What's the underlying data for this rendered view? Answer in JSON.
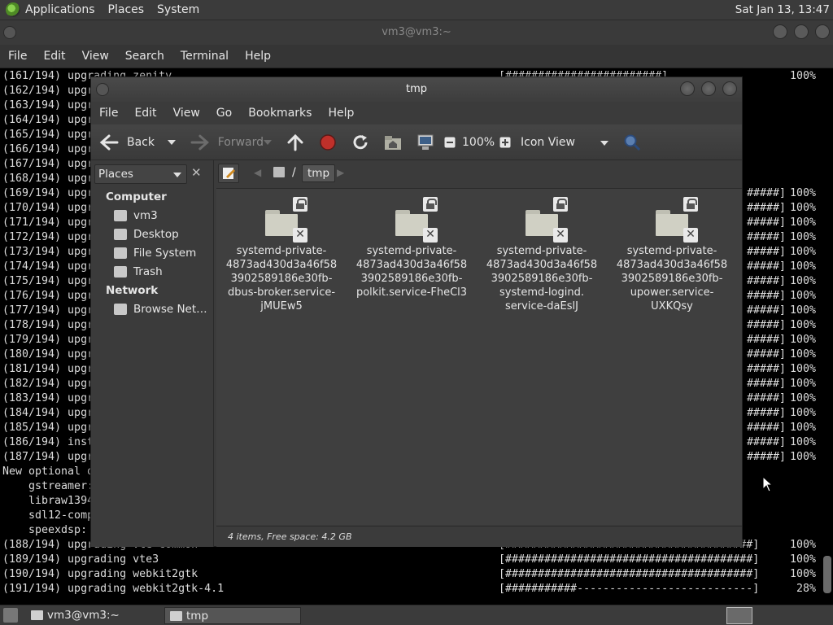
{
  "top_panel": {
    "menus": [
      "Applications",
      "Places",
      "System"
    ],
    "clock": "Sat Jan 13, 13:47"
  },
  "terminal": {
    "title": "vm3@vm3:~",
    "menus": [
      "File",
      "Edit",
      "View",
      "Search",
      "Terminal",
      "Help"
    ],
    "lines": [
      {
        "text": "(161/194) upgrading zenity",
        "bar": "[########################]",
        "pct": "100%"
      },
      {
        "text": "(162/194) upgr",
        "bar": "",
        "pct": ""
      },
      {
        "text": "(163/194) upgr",
        "bar": "",
        "pct": ""
      },
      {
        "text": "(164/194) upgr",
        "bar": "",
        "pct": ""
      },
      {
        "text": "(165/194) upgr",
        "bar": "",
        "pct": ""
      },
      {
        "text": "(166/194) upgr",
        "bar": "",
        "pct": ""
      },
      {
        "text": "(167/194) upgr",
        "bar": "",
        "pct": ""
      },
      {
        "text": "(168/194) upgr",
        "bar": "",
        "pct": ""
      },
      {
        "text": "(169/194) upgr",
        "bar": "#####]",
        "pct": "100%"
      },
      {
        "text": "(170/194) upgr",
        "bar": "#####]",
        "pct": "100%"
      },
      {
        "text": "(171/194) upgr",
        "bar": "#####]",
        "pct": "100%"
      },
      {
        "text": "(172/194) upgr",
        "bar": "#####]",
        "pct": "100%"
      },
      {
        "text": "(173/194) upgr",
        "bar": "#####]",
        "pct": "100%"
      },
      {
        "text": "(174/194) upgr",
        "bar": "#####]",
        "pct": "100%"
      },
      {
        "text": "(175/194) upgr",
        "bar": "#####]",
        "pct": "100%"
      },
      {
        "text": "(176/194) upgr",
        "bar": "#####]",
        "pct": "100%"
      },
      {
        "text": "(177/194) upgr",
        "bar": "#####]",
        "pct": "100%"
      },
      {
        "text": "(178/194) upgr",
        "bar": "#####]",
        "pct": "100%"
      },
      {
        "text": "(179/194) upgr",
        "bar": "#####]",
        "pct": "100%"
      },
      {
        "text": "(180/194) upgr",
        "bar": "#####]",
        "pct": "100%"
      },
      {
        "text": "(181/194) upgr",
        "bar": "#####]",
        "pct": "100%"
      },
      {
        "text": "(182/194) upgr",
        "bar": "#####]",
        "pct": "100%"
      },
      {
        "text": "(183/194) upgr",
        "bar": "#####]",
        "pct": "100%"
      },
      {
        "text": "(184/194) upgr",
        "bar": "#####]",
        "pct": "100%"
      },
      {
        "text": "(185/194) upgr",
        "bar": "#####]",
        "pct": "100%"
      },
      {
        "text": "(186/194) inst",
        "bar": "#####]",
        "pct": "100%"
      },
      {
        "text": "(187/194) upgr",
        "bar": "#####]",
        "pct": "100%"
      },
      {
        "text": "New optional d",
        "bar": "",
        "pct": ""
      },
      {
        "text": "    gstreamer:",
        "bar": "",
        "pct": ""
      },
      {
        "text": "    libraw1394",
        "bar": "",
        "pct": ""
      },
      {
        "text": "    sdl12-comp",
        "bar": "",
        "pct": ""
      },
      {
        "text": "    speexdsp:",
        "bar": "",
        "pct": ""
      },
      {
        "text": "(188/194) upgrading vte-common",
        "bar": "[######################################]",
        "pct": "100%"
      },
      {
        "text": "(189/194) upgrading vte3",
        "bar": "[######################################]",
        "pct": "100%"
      },
      {
        "text": "(190/194) upgrading webkit2gtk",
        "bar": "[######################################]",
        "pct": "100%"
      },
      {
        "text": "(191/194) upgrading webkit2gtk-4.1",
        "bar": "[###########---------------------------]",
        "pct": "28%"
      }
    ]
  },
  "fm": {
    "title": "tmp",
    "menus": [
      "File",
      "Edit",
      "View",
      "Go",
      "Bookmarks",
      "Help"
    ],
    "toolbar": {
      "back": "Back",
      "forward": "Forward",
      "zoom": "100%",
      "view_mode": "Icon View"
    },
    "sidebar": {
      "combo": "Places",
      "computer_heading": "Computer",
      "computer_items": [
        "vm3",
        "Desktop",
        "File System",
        "Trash"
      ],
      "network_heading": "Network",
      "network_items": [
        "Browse Net…"
      ]
    },
    "path": {
      "separator": "/",
      "current": "tmp"
    },
    "files": [
      {
        "name": "systemd-private-\n4873ad430d3a46f58\n3902589186e30fb-\ndbus-broker.service-\njMUEw5"
      },
      {
        "name": "systemd-private-\n4873ad430d3a46f58\n3902589186e30fb-\npolkit.service-FheCl3"
      },
      {
        "name": "systemd-private-\n4873ad430d3a46f58\n3902589186e30fb-\nsystemd-logind.\nservice-daEslJ"
      },
      {
        "name": "systemd-private-\n4873ad430d3a46f58\n3902589186e30fb-\nupower.service-\nUXKQsy"
      }
    ],
    "status": "4 items, Free space: 4.2 GB"
  },
  "taskbar": {
    "tasks": [
      "vm3@vm3:~",
      "tmp"
    ]
  }
}
